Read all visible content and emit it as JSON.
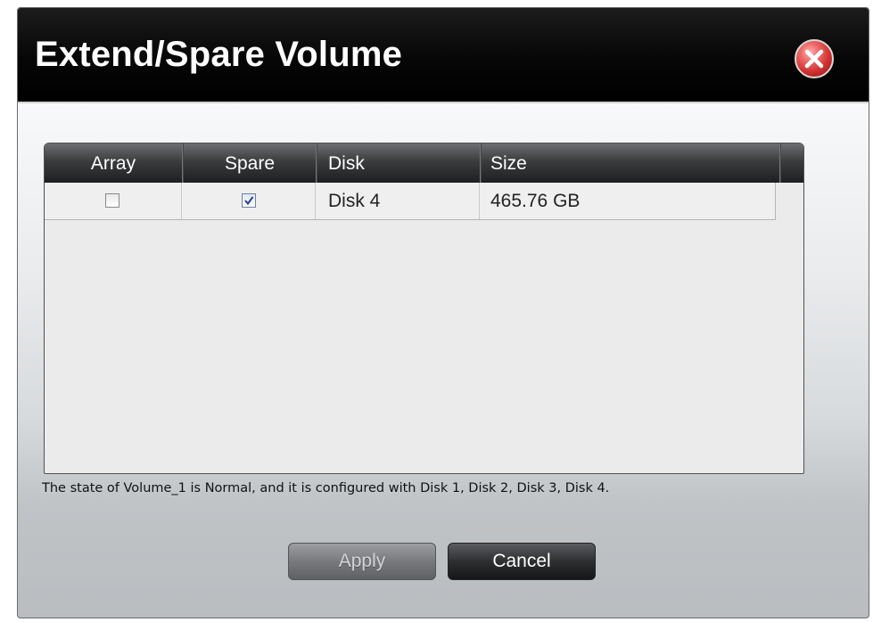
{
  "dialog": {
    "title": "Extend/Spare Volume",
    "close_icon": "close-icon"
  },
  "grid": {
    "columns": [
      "Array",
      "Spare",
      "Disk",
      "Size"
    ],
    "rows": [
      {
        "array_checked": false,
        "spare_checked": true,
        "disk": "Disk 4",
        "size": "465.76 GB"
      }
    ]
  },
  "status_text": "The state of Volume_1 is Normal, and it is configured with Disk 1, Disk 2, Disk 3, Disk 4.",
  "buttons": {
    "apply": "Apply",
    "cancel": "Cancel"
  },
  "colors": {
    "titlebar": "#000000",
    "close_button": "#cf3030",
    "grid_header": "#2b2d2f"
  }
}
